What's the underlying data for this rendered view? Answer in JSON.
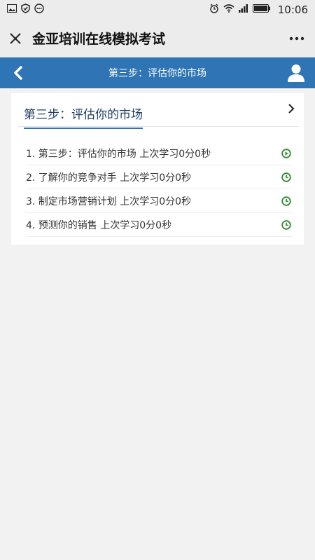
{
  "status_bar": {
    "time": "10:06",
    "icons": [
      "image-icon",
      "shield-icon",
      "message-icon",
      "alarm-icon",
      "wifi-icon",
      "signal-icon",
      "battery-icon"
    ]
  },
  "wechat_bar": {
    "title": "金亚培训在线模拟考试",
    "close_icon": "close-icon",
    "more_icon": "more-icon"
  },
  "header": {
    "title": "第三步：评估你的市场",
    "bg_color": "#2f75b5"
  },
  "card": {
    "title": "第三步：评估你的市场",
    "lessons": [
      {
        "label": "1. 第三步：评估你的市场 上次学习0分0秒",
        "icon": "play-circle-icon"
      },
      {
        "label": "2. 了解你的竞争对手 上次学习0分0秒",
        "icon": "clock-icon"
      },
      {
        "label": "3. 制定市场营销计划 上次学习0分0秒",
        "icon": "clock-icon"
      },
      {
        "label": "4. 预测你的销售 上次学习0分0秒",
        "icon": "clock-icon"
      }
    ],
    "icon_color": "#2e8b2e"
  }
}
